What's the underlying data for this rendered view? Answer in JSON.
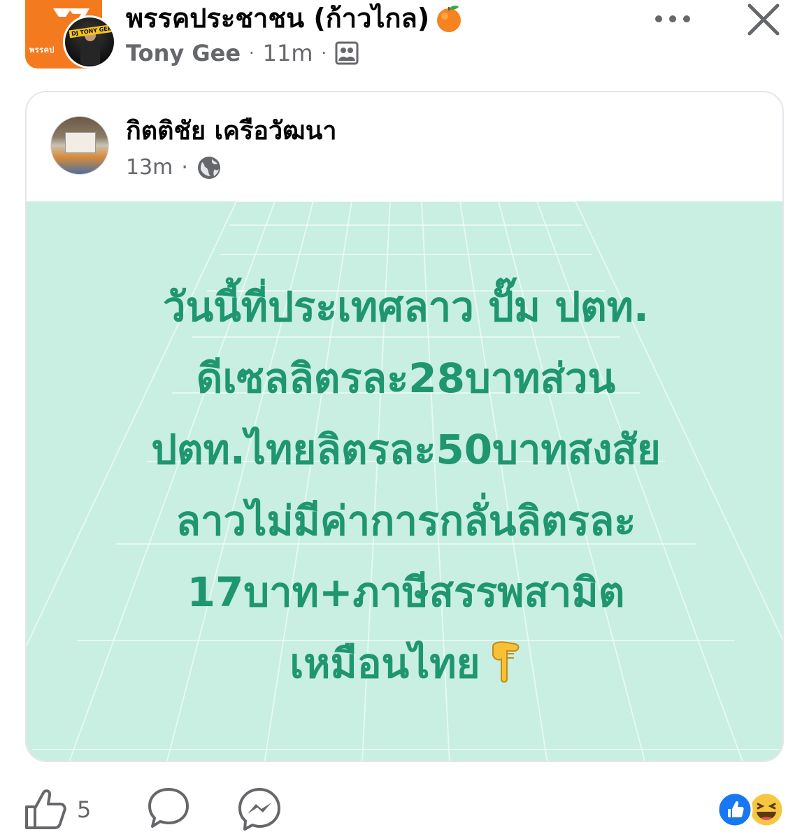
{
  "header": {
    "group_name": "พรรคประชาชน (ก้าวไกล)",
    "group_logo_text": "พรรคป",
    "author_avatar_tag": "DJ TONY GEE",
    "author": "Tony Gee",
    "time": "11m",
    "separator": "·",
    "audience_icon": "group-members-icon",
    "more_icon": "more-dots-icon",
    "close_icon": "close-icon"
  },
  "shared_post": {
    "author": "กิตติชัย เครือวัฒนา",
    "time": "13m",
    "separator": "·",
    "audience_icon": "globe-icon",
    "background_color": "#c8efe1",
    "text_color": "#1f9670",
    "lines": [
      "วันนี้ที่ประเทศลาว ปั๊ม ปตท.",
      "ดีเซลลิตรละ28บาทส่วน",
      "ปตท.ไทยลิตรละ50บาทสงสัย",
      "ลาวไม่มีค่าการกลั่นลิตรละ",
      "17บาท+ภาษีสรรพสามิต",
      "เหมือนไทย"
    ],
    "trailing_emoji": "pointing-down-hand-icon"
  },
  "actions": {
    "like_count": "5",
    "like_icon": "like-icon",
    "comment_icon": "comment-icon",
    "share_icon": "messenger-icon",
    "reactions": [
      "like-reaction-icon",
      "haha-reaction-icon"
    ]
  },
  "colors": {
    "orange_brand": "#f47a20",
    "like_blue": "#1877f2",
    "muted_text": "#65676b"
  }
}
